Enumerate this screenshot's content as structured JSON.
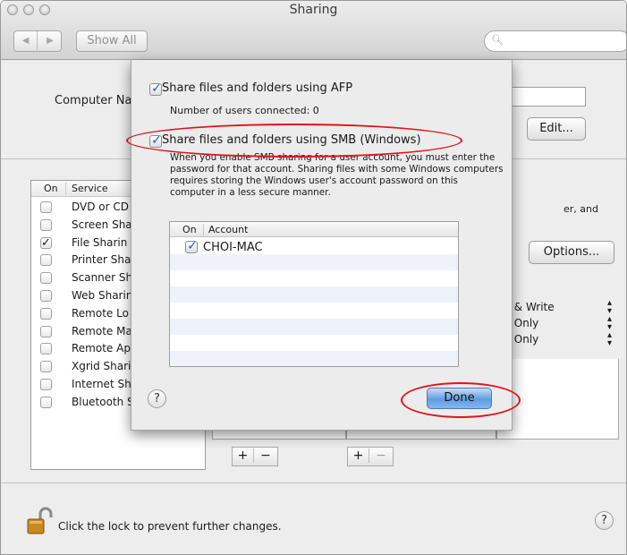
{
  "window": {
    "title": "Sharing"
  },
  "toolbar": {
    "show_all_label": "Show All",
    "search_placeholder": ""
  },
  "main": {
    "computer_name_label": "Computer Na",
    "edit_button": "Edit...",
    "services_header": {
      "on": "On",
      "service": "Service"
    },
    "services": [
      {
        "name": "DVD or CD",
        "checked": false
      },
      {
        "name": "Screen Sha",
        "checked": false
      },
      {
        "name": "File Sharin",
        "checked": true
      },
      {
        "name": "Printer Sha",
        "checked": false
      },
      {
        "name": "Scanner Sh",
        "checked": false
      },
      {
        "name": "Web Sharin",
        "checked": false
      },
      {
        "name": "Remote Lo",
        "checked": false
      },
      {
        "name": "Remote Ma",
        "checked": false
      },
      {
        "name": "Remote Ap",
        "checked": false
      },
      {
        "name": "Xgrid Shari",
        "checked": false
      },
      {
        "name": "Internet Sh",
        "checked": false
      },
      {
        "name": "Bluetooth Sharing",
        "checked": false
      }
    ],
    "right_description": "er, and",
    "options_button": "Options...",
    "permissions": [
      {
        "label": "ad & Write"
      },
      {
        "label": "ad Only"
      },
      {
        "label": "ad Only"
      }
    ],
    "plus": "+",
    "minus": "−",
    "lock_text": "Click the lock to prevent further changes.",
    "help": "?"
  },
  "sheet": {
    "afp": {
      "label": "Share files and folders using AFP",
      "checked": true
    },
    "users_connected": "Number of users connected: 0",
    "smb": {
      "label": "Share files and folders using SMB (Windows)",
      "checked": true
    },
    "smb_description": "When you enable SMB sharing for a user account, you must enter the password for that account. Sharing files with some Windows computers requires storing the Windows user's account password on this computer in a less secure manner.",
    "account_table": {
      "headers": {
        "on": "On",
        "account": "Account"
      },
      "rows": [
        {
          "checked": true,
          "account": "CHOI-MAC"
        }
      ]
    },
    "help": "?",
    "done_button": "Done"
  },
  "colors": {
    "annotation_red": "#e0141b",
    "accent_blue": "#5f9de2"
  }
}
